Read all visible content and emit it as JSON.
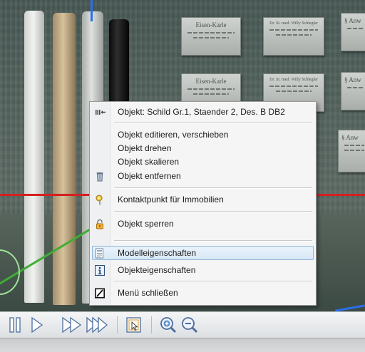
{
  "context_menu": {
    "header": "Objekt: Schild Gr.1, Staender 2, Des. B DB2",
    "items": [
      {
        "label": "Objekt editieren, verschieben"
      },
      {
        "label": "Objekt drehen"
      },
      {
        "label": "Objekt skalieren"
      },
      {
        "label": "Objekt entfernen"
      },
      {
        "label": "Kontaktpunkt für Immobilien"
      },
      {
        "label": "Objekt sperren"
      },
      {
        "label": "Modelleigenschaften"
      },
      {
        "label": "Objekteigenschaften"
      },
      {
        "label": "Menü schließen"
      }
    ],
    "highlighted_item": "Modelleigenschaften"
  },
  "scene": {
    "signs": [
      {
        "title": "Eisen-Karle"
      },
      {
        "title": "Dr. St. med. Willy Schlegler"
      },
      {
        "title": "§ Anw"
      },
      {
        "title": "Eisen-Karle"
      },
      {
        "title": "Dr. St. med. Willy Schlegler"
      },
      {
        "title": "§ Anw"
      },
      {
        "title": "§ Anw"
      }
    ]
  },
  "icons": {
    "header": "object-arrow-icon",
    "delete": "trash-bin-icon",
    "contact": "key-badge-icon",
    "lock": "padlock-icon",
    "model_props": "properties-sheet-icon",
    "object_props": "info-icon",
    "close": "close-slash-icon"
  },
  "toolbar": {
    "buttons": [
      "pause-icon",
      "play-icon",
      "fast-forward-icon",
      "fastest-forward-icon",
      "select-arrow-icon",
      "zoom-in-icon",
      "zoom-out-icon"
    ]
  },
  "colors": {
    "highlight_bg": "#d7e8f7",
    "highlight_border": "#8fb4d8",
    "menu_bg": "#f5f5f5",
    "rail_red": "#d42020",
    "rail_green": "#3fae34",
    "rail_blue": "#2a6ee8"
  }
}
